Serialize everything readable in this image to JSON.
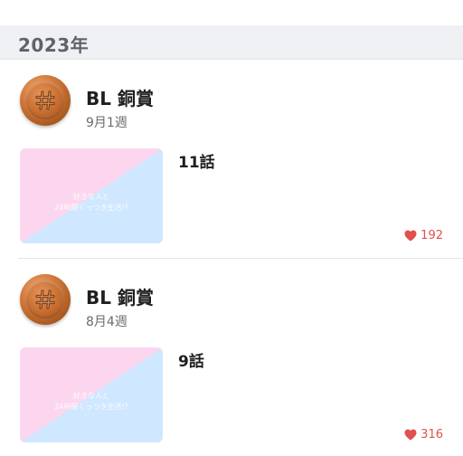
{
  "year_section": {
    "label": "2023年"
  },
  "entries": [
    {
      "award": "BL 銅賞",
      "week": "9月1週",
      "thumbnail_text": [
        "好きな人と",
        "24時間くっつき生活!?"
      ],
      "episode": "11話",
      "likes": "192"
    },
    {
      "award": "BL 銅賞",
      "week": "8月4週",
      "thumbnail_text": [
        "好きな人と",
        "24時間くっつき生活!?"
      ],
      "episode": "9話",
      "likes": "316"
    }
  ],
  "colors": {
    "like_red": "#e0504d",
    "medal_bronze": "#c2692c",
    "header_bg": "#eef0f3"
  },
  "icons": {
    "medal": "bronze-medal-hash-icon",
    "like": "heart-icon"
  }
}
